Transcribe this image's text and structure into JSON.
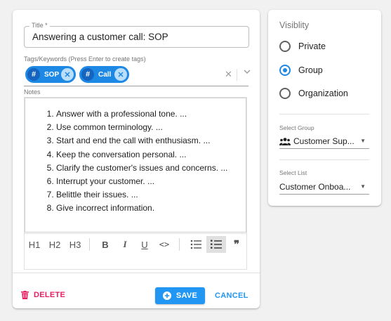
{
  "title_field": {
    "label": "Title *",
    "value": "Answering a customer call: SOP"
  },
  "tags": {
    "label": "Tags/Keywords (Press Enter to create tags)",
    "items": [
      {
        "label": "SOP"
      },
      {
        "label": "Call"
      }
    ],
    "clear_icon": "close-icon",
    "dropdown_icon": "chevron-down-icon"
  },
  "notes": {
    "label": "Notes",
    "items": [
      "Answer with a professional tone. ...",
      "Use common terminology. ...",
      "Start and end the call with enthusiasm. ...",
      "Keep the conversation personal. ...",
      "Clarify the customer's issues and concerns. ...",
      "Interrupt your customer. ...",
      "Belittle their issues. ...",
      "Give incorrect information."
    ]
  },
  "toolbar": {
    "h1": "H1",
    "h2": "H2",
    "h3": "H3",
    "bold": "B",
    "italic": "I",
    "underline": "U",
    "code": "<>",
    "quote": "❞"
  },
  "actions": {
    "delete": "DELETE",
    "save": "SAVE",
    "cancel": "CANCEL"
  },
  "visibility": {
    "title": "Visiblity",
    "options": [
      "Private",
      "Group",
      "Organization"
    ],
    "selected": "Group"
  },
  "group_select": {
    "label": "Select Group",
    "value": "Customer Sup..."
  },
  "list_select": {
    "label": "Select List",
    "value": "Customer Onboa..."
  },
  "colors": {
    "accent": "#2196f3",
    "danger": "#e91e63",
    "chip": "#1e88e5"
  }
}
